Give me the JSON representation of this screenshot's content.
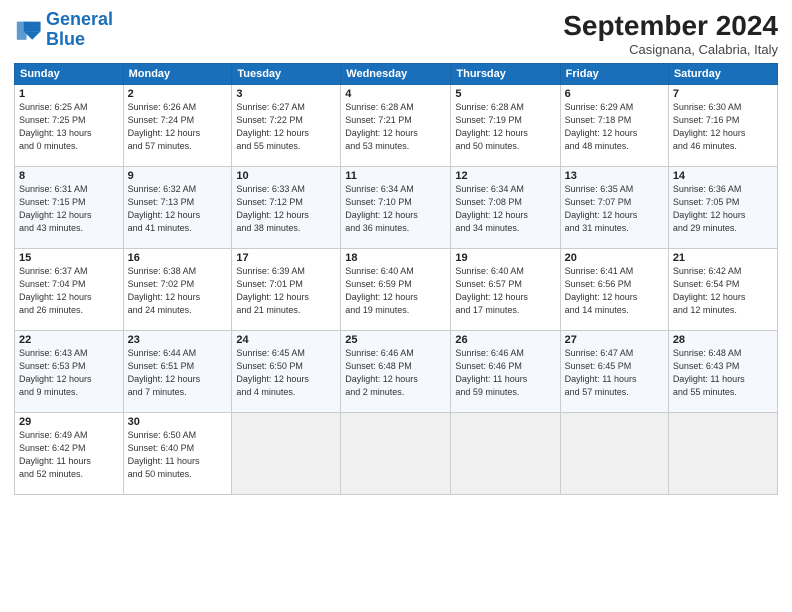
{
  "logo": {
    "line1": "General",
    "line2": "Blue"
  },
  "title": "September 2024",
  "subtitle": "Casignana, Calabria, Italy",
  "headers": [
    "Sunday",
    "Monday",
    "Tuesday",
    "Wednesday",
    "Thursday",
    "Friday",
    "Saturday"
  ],
  "weeks": [
    [
      {
        "day": "1",
        "info": "Sunrise: 6:25 AM\nSunset: 7:25 PM\nDaylight: 13 hours\nand 0 minutes."
      },
      {
        "day": "2",
        "info": "Sunrise: 6:26 AM\nSunset: 7:24 PM\nDaylight: 12 hours\nand 57 minutes."
      },
      {
        "day": "3",
        "info": "Sunrise: 6:27 AM\nSunset: 7:22 PM\nDaylight: 12 hours\nand 55 minutes."
      },
      {
        "day": "4",
        "info": "Sunrise: 6:28 AM\nSunset: 7:21 PM\nDaylight: 12 hours\nand 53 minutes."
      },
      {
        "day": "5",
        "info": "Sunrise: 6:28 AM\nSunset: 7:19 PM\nDaylight: 12 hours\nand 50 minutes."
      },
      {
        "day": "6",
        "info": "Sunrise: 6:29 AM\nSunset: 7:18 PM\nDaylight: 12 hours\nand 48 minutes."
      },
      {
        "day": "7",
        "info": "Sunrise: 6:30 AM\nSunset: 7:16 PM\nDaylight: 12 hours\nand 46 minutes."
      }
    ],
    [
      {
        "day": "8",
        "info": "Sunrise: 6:31 AM\nSunset: 7:15 PM\nDaylight: 12 hours\nand 43 minutes."
      },
      {
        "day": "9",
        "info": "Sunrise: 6:32 AM\nSunset: 7:13 PM\nDaylight: 12 hours\nand 41 minutes."
      },
      {
        "day": "10",
        "info": "Sunrise: 6:33 AM\nSunset: 7:12 PM\nDaylight: 12 hours\nand 38 minutes."
      },
      {
        "day": "11",
        "info": "Sunrise: 6:34 AM\nSunset: 7:10 PM\nDaylight: 12 hours\nand 36 minutes."
      },
      {
        "day": "12",
        "info": "Sunrise: 6:34 AM\nSunset: 7:08 PM\nDaylight: 12 hours\nand 34 minutes."
      },
      {
        "day": "13",
        "info": "Sunrise: 6:35 AM\nSunset: 7:07 PM\nDaylight: 12 hours\nand 31 minutes."
      },
      {
        "day": "14",
        "info": "Sunrise: 6:36 AM\nSunset: 7:05 PM\nDaylight: 12 hours\nand 29 minutes."
      }
    ],
    [
      {
        "day": "15",
        "info": "Sunrise: 6:37 AM\nSunset: 7:04 PM\nDaylight: 12 hours\nand 26 minutes."
      },
      {
        "day": "16",
        "info": "Sunrise: 6:38 AM\nSunset: 7:02 PM\nDaylight: 12 hours\nand 24 minutes."
      },
      {
        "day": "17",
        "info": "Sunrise: 6:39 AM\nSunset: 7:01 PM\nDaylight: 12 hours\nand 21 minutes."
      },
      {
        "day": "18",
        "info": "Sunrise: 6:40 AM\nSunset: 6:59 PM\nDaylight: 12 hours\nand 19 minutes."
      },
      {
        "day": "19",
        "info": "Sunrise: 6:40 AM\nSunset: 6:57 PM\nDaylight: 12 hours\nand 17 minutes."
      },
      {
        "day": "20",
        "info": "Sunrise: 6:41 AM\nSunset: 6:56 PM\nDaylight: 12 hours\nand 14 minutes."
      },
      {
        "day": "21",
        "info": "Sunrise: 6:42 AM\nSunset: 6:54 PM\nDaylight: 12 hours\nand 12 minutes."
      }
    ],
    [
      {
        "day": "22",
        "info": "Sunrise: 6:43 AM\nSunset: 6:53 PM\nDaylight: 12 hours\nand 9 minutes."
      },
      {
        "day": "23",
        "info": "Sunrise: 6:44 AM\nSunset: 6:51 PM\nDaylight: 12 hours\nand 7 minutes."
      },
      {
        "day": "24",
        "info": "Sunrise: 6:45 AM\nSunset: 6:50 PM\nDaylight: 12 hours\nand 4 minutes."
      },
      {
        "day": "25",
        "info": "Sunrise: 6:46 AM\nSunset: 6:48 PM\nDaylight: 12 hours\nand 2 minutes."
      },
      {
        "day": "26",
        "info": "Sunrise: 6:46 AM\nSunset: 6:46 PM\nDaylight: 11 hours\nand 59 minutes."
      },
      {
        "day": "27",
        "info": "Sunrise: 6:47 AM\nSunset: 6:45 PM\nDaylight: 11 hours\nand 57 minutes."
      },
      {
        "day": "28",
        "info": "Sunrise: 6:48 AM\nSunset: 6:43 PM\nDaylight: 11 hours\nand 55 minutes."
      }
    ],
    [
      {
        "day": "29",
        "info": "Sunrise: 6:49 AM\nSunset: 6:42 PM\nDaylight: 11 hours\nand 52 minutes."
      },
      {
        "day": "30",
        "info": "Sunrise: 6:50 AM\nSunset: 6:40 PM\nDaylight: 11 hours\nand 50 minutes."
      },
      {
        "day": "",
        "info": ""
      },
      {
        "day": "",
        "info": ""
      },
      {
        "day": "",
        "info": ""
      },
      {
        "day": "",
        "info": ""
      },
      {
        "day": "",
        "info": ""
      }
    ]
  ]
}
